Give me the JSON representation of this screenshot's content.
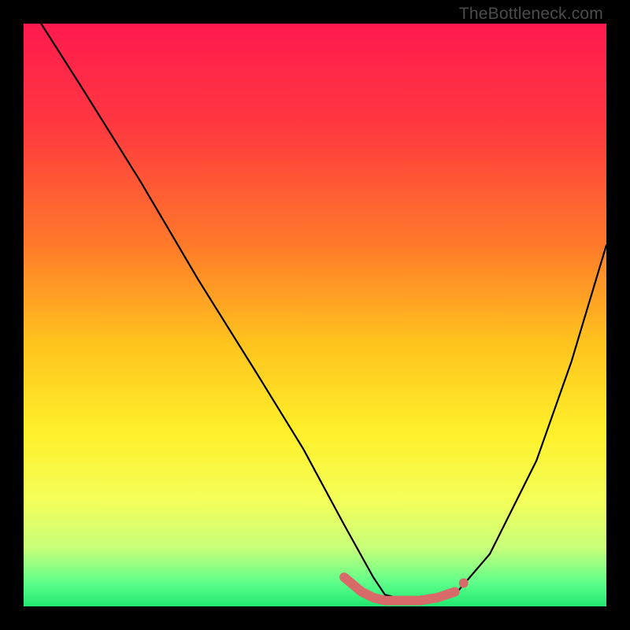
{
  "watermark": {
    "text": "TheBottleneck.com"
  },
  "gradient": {
    "stops": [
      {
        "pct": 0,
        "color": "#ff1a4f"
      },
      {
        "pct": 18,
        "color": "#ff3a3f"
      },
      {
        "pct": 38,
        "color": "#ff7a2a"
      },
      {
        "pct": 55,
        "color": "#ffc41e"
      },
      {
        "pct": 70,
        "color": "#fff02a"
      },
      {
        "pct": 82,
        "color": "#f3ff5a"
      },
      {
        "pct": 90,
        "color": "#c8ff7a"
      },
      {
        "pct": 96,
        "color": "#5dff8a"
      },
      {
        "pct": 100,
        "color": "#20e870"
      }
    ]
  },
  "chart_data": {
    "type": "line",
    "title": "",
    "xlabel": "",
    "ylabel": "",
    "xlim": [
      0,
      100
    ],
    "ylim": [
      0,
      100
    ],
    "series": [
      {
        "name": "curve",
        "x": [
          3,
          10,
          20,
          30,
          40,
          48,
          55,
          60,
          62,
          66,
          70,
          74,
          80,
          88,
          94,
          100
        ],
        "y": [
          100,
          89,
          73,
          56,
          40,
          27,
          14,
          5,
          2,
          1,
          1,
          2,
          9,
          25,
          42,
          62
        ]
      }
    ],
    "highlight_segment": {
      "color": "#d86a6a",
      "width": 12,
      "x": [
        55,
        58,
        60,
        62,
        65,
        68,
        71,
        74
      ],
      "y": [
        5,
        2.5,
        1.5,
        1,
        1,
        1,
        1.5,
        2.5
      ]
    },
    "highlight_dot": {
      "x": 75.5,
      "y": 4,
      "r": 6,
      "color": "#d86a6a"
    }
  }
}
